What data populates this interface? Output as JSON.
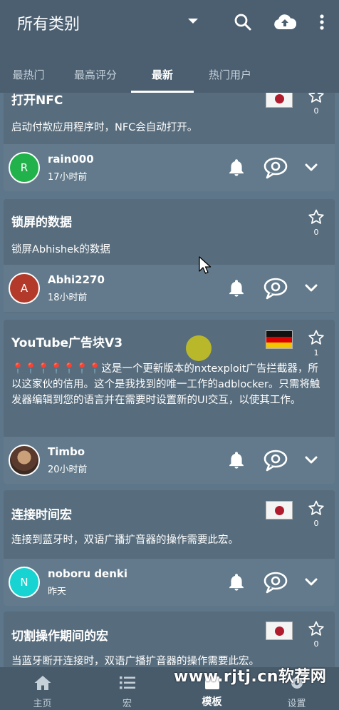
{
  "header": {
    "title": "所有类别",
    "icons": [
      "dropdown-arrow-icon",
      "search-icon",
      "cloud-upload-icon",
      "more-vert-icon"
    ]
  },
  "tabs": [
    {
      "label": "最热门",
      "active": false
    },
    {
      "label": "最高评分",
      "active": false
    },
    {
      "label": "最新",
      "active": true
    },
    {
      "label": "热门用户",
      "active": false
    }
  ],
  "cards": [
    {
      "title": "打开NFC",
      "desc": "启动付款应用程序时，NFC会自动打开。",
      "flag": "japan",
      "stars": "0",
      "user": {
        "name": "rain000",
        "initial": "R",
        "avatar_color": "#22b24c",
        "time": "17小时前"
      }
    },
    {
      "title": "锁屏的数据",
      "desc": "锁屏Abhishek的数据",
      "flag": "",
      "stars": "0",
      "user": {
        "name": "Abhi2270",
        "initial": "A",
        "avatar_color": "#b33a2a",
        "time": "18小时前"
      }
    },
    {
      "title": "YouTube广告块V3",
      "desc": "📍📍📍📍📍📍📍这是一个更新版本的nxtexploit广告拦截器，所以这家伙的信用。这个是我找到的唯一工作的adblocker。只需将触发器编辑到您的语言并在需要时设置新的UI交互，以使其工作。",
      "flag": "germany",
      "stars": "1",
      "user": {
        "name": "Timbo",
        "initial": "",
        "avatar_color": "#6b4a3a",
        "time": "20小时前"
      }
    },
    {
      "title": "连接时间宏",
      "desc": "连接到蓝牙时，双语广播扩音器的操作需要此宏。",
      "flag": "japan",
      "stars": "0",
      "user": {
        "name": "noboru denki",
        "initial": "N",
        "avatar_color": "#17d3d1",
        "time": "昨天"
      }
    },
    {
      "title": "切割操作期间的宏",
      "desc": "当蓝牙断开连接时，双语广播扩音器的操作需要此宏。",
      "flag": "japan",
      "stars": "0"
    }
  ],
  "bottom_nav": [
    {
      "label": "主页",
      "icon": "home-icon",
      "active": false
    },
    {
      "label": "宏",
      "icon": "list-icon",
      "active": false
    },
    {
      "label": "模板",
      "icon": "template-icon",
      "active": true
    },
    {
      "label": "设置",
      "icon": "settings-icon",
      "active": false
    }
  ],
  "watermark": "www.rjtj.cn软荐网",
  "colors": {
    "app_bar": "#4b5f70",
    "card": "#576c7c",
    "card_footer": "#627a8b",
    "bottom_nav": "#485b6b"
  }
}
